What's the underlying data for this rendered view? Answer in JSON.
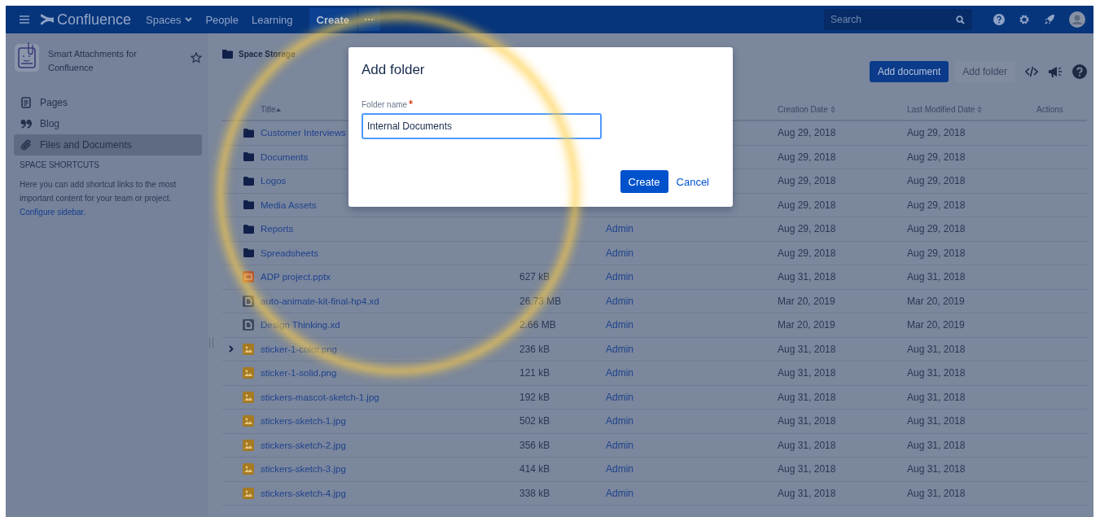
{
  "topbar": {
    "product": "Confluence",
    "nav": [
      {
        "label": "Spaces",
        "dropdown": true
      },
      {
        "label": "People",
        "dropdown": false
      },
      {
        "label": "Learning",
        "dropdown": false
      }
    ],
    "create": "Create",
    "more": "···",
    "search": {
      "placeholder": "Search"
    }
  },
  "sidebar": {
    "space_name": "Smart Attachments for Confluence",
    "items": [
      {
        "label": "Pages",
        "kind": "page",
        "selected": false
      },
      {
        "label": "Blog",
        "kind": "quote",
        "selected": false
      },
      {
        "label": "Files and Documents",
        "kind": "clip",
        "selected": true
      }
    ],
    "shortcuts_heading": "SPACE SHORTCUTS",
    "shortcuts_text": "Here you can add shortcut links to the most important content for your team or project.",
    "configure_link": "Configure sidebar."
  },
  "breadcrumb": "Space Storage",
  "toolbar": {
    "primary": "Add document",
    "secondary": "Add folder"
  },
  "table": {
    "columns": [
      {
        "label": "Title",
        "sortable": true,
        "sorted": true
      },
      {},
      {},
      {
        "label": "Creation Date",
        "sortable": true,
        "sorted": false
      },
      {
        "label": "Last Modified Date",
        "sortable": true,
        "sorted": false
      },
      {
        "label": "Actions"
      }
    ],
    "rows": [
      {
        "kind": "folder",
        "title": "Customer Interviews",
        "created": "Aug 29, 2018",
        "modified": "Aug 29, 2018",
        "expandable": false
      },
      {
        "kind": "folder",
        "title": "Documents",
        "created": "Aug 29, 2018",
        "modified": "Aug 29, 2018",
        "expandable": false
      },
      {
        "kind": "folder",
        "title": "Logos",
        "created": "Aug 29, 2018",
        "modified": "Aug 29, 2018",
        "expandable": false
      },
      {
        "kind": "folder",
        "title": "Media Assets",
        "created": "Aug 29, 2018",
        "modified": "Aug 29, 2018",
        "expandable": false
      },
      {
        "kind": "folder",
        "title": "Reports",
        "creator": "Admin",
        "created": "Aug 29, 2018",
        "modified": "Aug 29, 2018",
        "expandable": false
      },
      {
        "kind": "folder",
        "title": "Spreadsheets",
        "creator": "Admin",
        "created": "Aug 29, 2018",
        "modified": "Aug 29, 2018",
        "expandable": false
      },
      {
        "kind": "slides",
        "title": "ADP project.pptx",
        "size": "627 kB",
        "creator": "Admin",
        "created": "Aug 31, 2018",
        "modified": "Aug 31, 2018",
        "expandable": false
      },
      {
        "kind": "file",
        "title": "auto-animate-kit-final-hp4.xd",
        "size": "26.73 MB",
        "creator": "Admin",
        "created": "Mar 20, 2019",
        "modified": "Mar 20, 2019",
        "expandable": false
      },
      {
        "kind": "file",
        "title": "Design Thinking.xd",
        "size": "2.66 MB",
        "creator": "Admin",
        "created": "Mar 20, 2019",
        "modified": "Mar 20, 2019",
        "expandable": false
      },
      {
        "kind": "image",
        "title": "sticker-1-color.png",
        "size": "236 kB",
        "creator": "Admin",
        "created": "Aug 31, 2018",
        "modified": "Aug 31, 2018",
        "expandable": true
      },
      {
        "kind": "image",
        "title": "sticker-1-solid.png",
        "size": "121 kB",
        "creator": "Admin",
        "created": "Aug 31, 2018",
        "modified": "Aug 31, 2018",
        "expandable": false
      },
      {
        "kind": "image",
        "title": "stickers-mascot-sketch-1.jpg",
        "size": "192 kB",
        "creator": "Admin",
        "created": "Aug 31, 2018",
        "modified": "Aug 31, 2018",
        "expandable": false
      },
      {
        "kind": "image",
        "title": "stickers-sketch-1.jpg",
        "size": "502 kB",
        "creator": "Admin",
        "created": "Aug 31, 2018",
        "modified": "Aug 31, 2018",
        "expandable": false
      },
      {
        "kind": "image",
        "title": "stickers-sketch-2.jpg",
        "size": "356 kB",
        "creator": "Admin",
        "created": "Aug 31, 2018",
        "modified": "Aug 31, 2018",
        "expandable": false
      },
      {
        "kind": "image",
        "title": "stickers-sketch-3.jpg",
        "size": "414 kB",
        "creator": "Admin",
        "created": "Aug 31, 2018",
        "modified": "Aug 31, 2018",
        "expandable": false
      },
      {
        "kind": "image",
        "title": "stickers-sketch-4.jpg",
        "size": "338 kB",
        "creator": "Admin",
        "created": "Aug 31, 2018",
        "modified": "Aug 31, 2018",
        "expandable": false
      }
    ]
  },
  "dialog": {
    "title": "Add folder",
    "field_label": "Folder name",
    "required": true,
    "value": "Internal Documents",
    "confirm": "Create",
    "cancel": "Cancel"
  }
}
